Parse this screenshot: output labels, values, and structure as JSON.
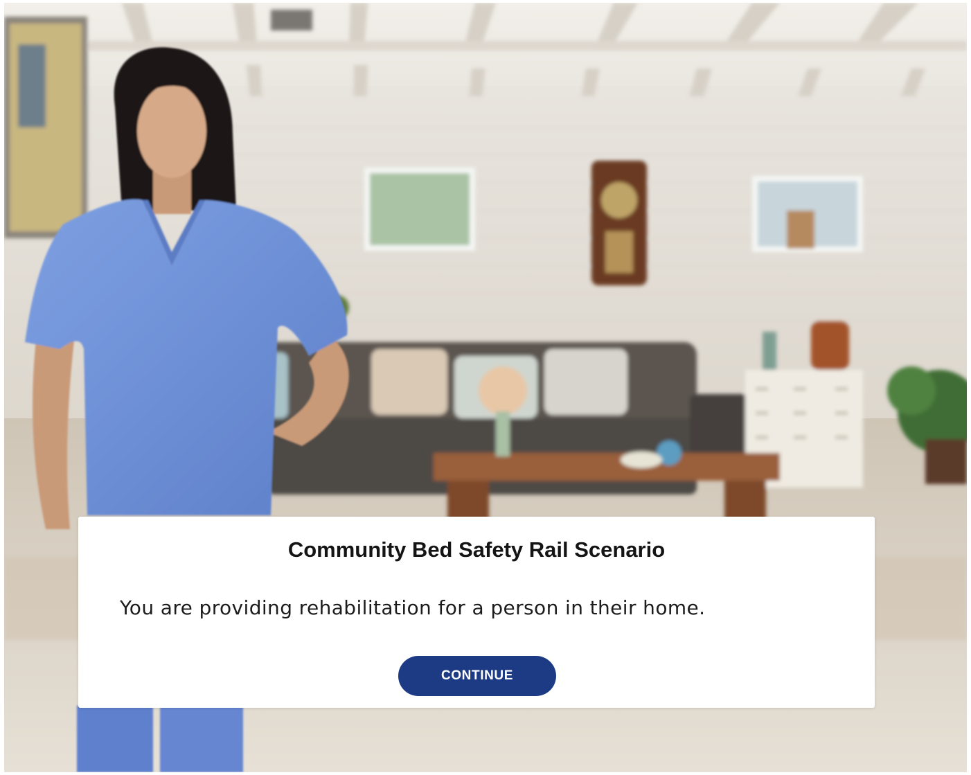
{
  "scenario": {
    "title": "Community Bed Safety Rail Scenario",
    "body": "You are providing rehabilitation for a person in their home.",
    "continue_label": "CONTINUE"
  },
  "background": {
    "icon": "living-room-scene",
    "character_icon": "nurse-in-blue-scrubs"
  },
  "colors": {
    "button": "#1d3b84",
    "scrubs": "#6b8fd6",
    "dialog": "#ffffff"
  }
}
